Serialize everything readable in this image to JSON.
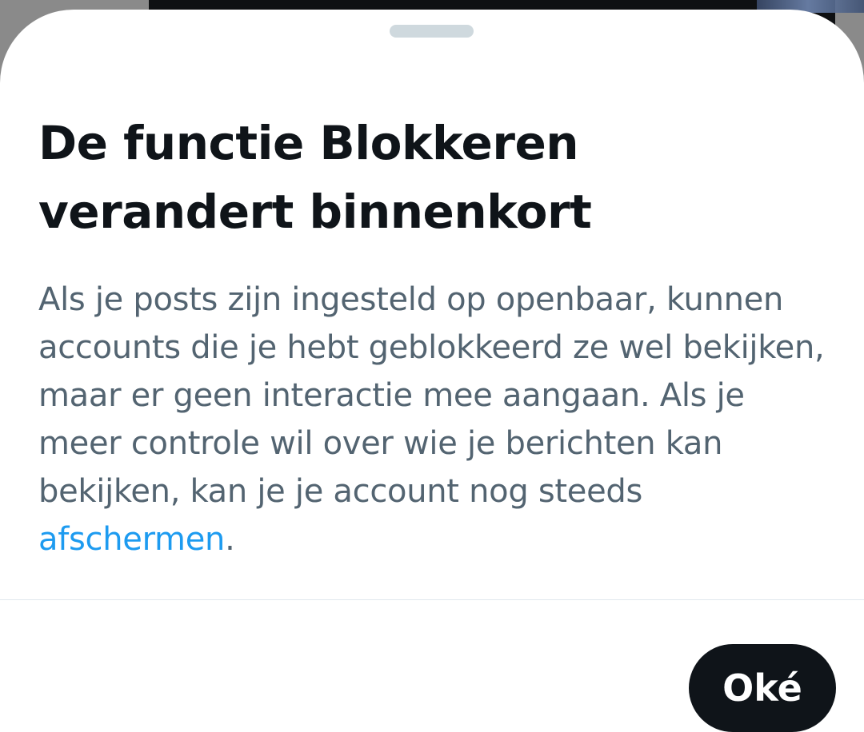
{
  "sheet": {
    "title": "De functie Blokkeren verandert binnenkort",
    "body_text": "Als je posts zijn ingesteld op openbaar, kunnen accounts die je hebt geblokkeerd ze wel bekijken, maar er geen interactie mee aangaan. Als je meer controle wil over wie je berichten kan bekijken, kan je je account nog steeds ",
    "link_text": "afschermen",
    "body_end": ".",
    "ok_label": "Oké"
  },
  "colors": {
    "title": "#0f1419",
    "body": "#536471",
    "link": "#1d9bf0",
    "button_bg": "#0f1419",
    "button_text": "#ffffff",
    "grabber": "#cfd9de"
  }
}
